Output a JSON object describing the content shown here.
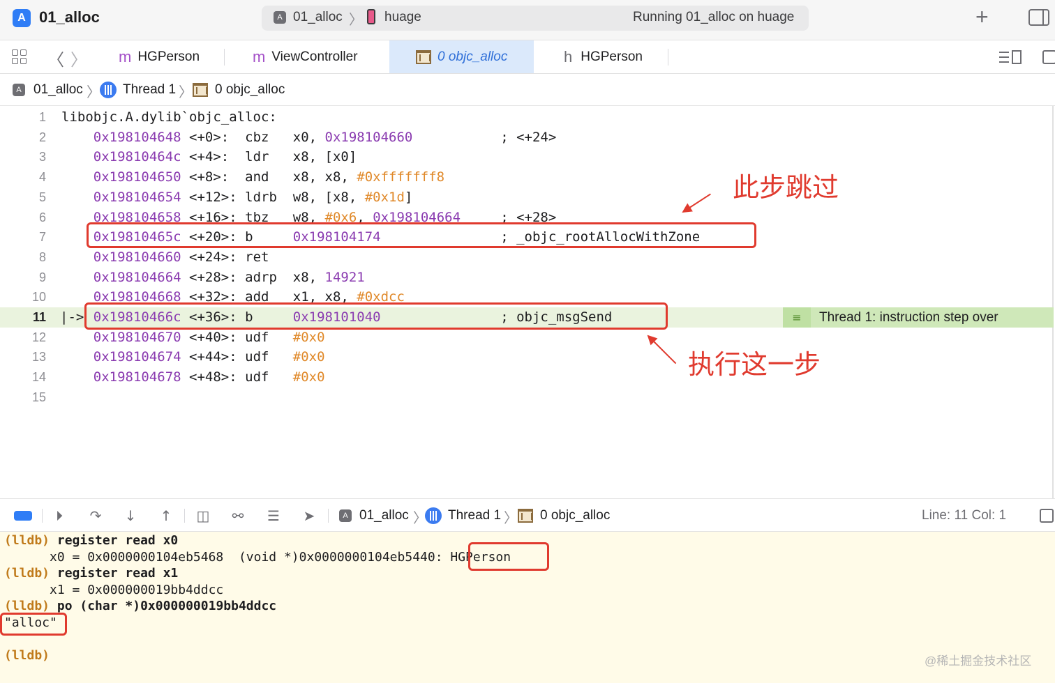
{
  "titlebar": {
    "app_title": "01_alloc",
    "scheme_target": "01_alloc",
    "device": "huage",
    "status": "Running 01_alloc on huage",
    "add_label": "+"
  },
  "tabs": [
    {
      "kind": "m",
      "label": "HGPerson"
    },
    {
      "kind": "m",
      "label": "ViewController"
    },
    {
      "kind": "asm",
      "label": "0 objc_alloc",
      "active": true
    },
    {
      "kind": "h",
      "label": "HGPerson"
    }
  ],
  "jumpbar": {
    "project": "01_alloc",
    "thread": "Thread 1",
    "frame": "0 objc_alloc"
  },
  "editor": {
    "lines": [
      {
        "n": "1",
        "addr": "",
        "off": "",
        "op": "",
        "args": "libobjc.A.dylib`objc_alloc:",
        "comment": ""
      },
      {
        "n": "2",
        "addr": "0x198104648",
        "off": " <+0>:  ",
        "op": "cbz ",
        "args": "x0, ",
        "arg_addr": "0x198104660",
        "comment": "; <+24>"
      },
      {
        "n": "3",
        "addr": "0x19810464c",
        "off": " <+4>:  ",
        "op": "ldr ",
        "args": "x8, [x0]",
        "comment": ""
      },
      {
        "n": "4",
        "addr": "0x198104650",
        "off": " <+8>:  ",
        "op": "and ",
        "args": "x8, x8, ",
        "arg_num": "#0xfffffff8",
        "comment": ""
      },
      {
        "n": "5",
        "addr": "0x198104654",
        "off": " <+12>: ",
        "op": "ldrb",
        "args": "w8, [x8, ",
        "arg_num": "#0x1d",
        "tail": "]",
        "comment": ""
      },
      {
        "n": "6",
        "addr": "0x198104658",
        "off": " <+16>: ",
        "op": "tbz ",
        "args": "w8, ",
        "arg_num": "#0x6",
        "tail": ", ",
        "arg_addr": "0x198104664",
        "comment": "; <+28>"
      },
      {
        "n": "7",
        "addr": "0x19810465c",
        "off": " <+20>: ",
        "op": "b   ",
        "args": "",
        "arg_addr": "0x198104174",
        "comment": "; _objc_rootAllocWithZone"
      },
      {
        "n": "8",
        "addr": "0x198104660",
        "off": " <+24>: ",
        "op": "ret ",
        "args": "",
        "comment": ""
      },
      {
        "n": "9",
        "addr": "0x198104664",
        "off": " <+28>: ",
        "op": "adrp",
        "args": "x8, ",
        "arg_addr": "14921",
        "comment": ""
      },
      {
        "n": "10",
        "addr": "0x198104668",
        "off": " <+32>: ",
        "op": "add ",
        "args": "x1, x8, ",
        "arg_num": "#0xdcc",
        "comment": ""
      },
      {
        "n": "11",
        "addr": "0x19810466c",
        "off": " <+36>: ",
        "op": "b   ",
        "args": "",
        "arg_addr": "0x198101040",
        "comment": "; objc_msgSend",
        "current": true
      },
      {
        "n": "12",
        "addr": "0x198104670",
        "off": " <+40>: ",
        "op": "udf ",
        "args": "",
        "arg_num": "#0x0",
        "comment": ""
      },
      {
        "n": "13",
        "addr": "0x198104674",
        "off": " <+44>: ",
        "op": "udf ",
        "args": "",
        "arg_num": "#0x0",
        "comment": ""
      },
      {
        "n": "14",
        "addr": "0x198104678",
        "off": " <+48>: ",
        "op": "udf ",
        "args": "",
        "arg_num": "#0x0",
        "comment": ""
      },
      {
        "n": "15",
        "addr": "",
        "off": "",
        "op": "",
        "args": "",
        "comment": ""
      }
    ],
    "pc_marker": "|->",
    "thread_annotation": "Thread 1: instruction step over",
    "annotation_skip": "此步跳过",
    "annotation_exec": "执行这一步"
  },
  "debugbar": {
    "project": "01_alloc",
    "thread": "Thread 1",
    "frame": "0 objc_alloc",
    "line_col": "Line: 11  Col: 1"
  },
  "console": {
    "lines": [
      {
        "prompt": "(lldb)",
        "text": " register read x0"
      },
      {
        "prompt": "",
        "text": "      x0 = 0x0000000104eb5468  (void *)0x0000000104eb5440: HGPerson"
      },
      {
        "prompt": "(lldb)",
        "text": " register read x1"
      },
      {
        "prompt": "",
        "text": "      x1 = 0x000000019bb4ddcc"
      },
      {
        "prompt": "(lldb)",
        "text": " po (char *)0x000000019bb4ddcc"
      },
      {
        "prompt": "",
        "text": "\"alloc\""
      },
      {
        "prompt": "",
        "text": ""
      },
      {
        "prompt": "(lldb)",
        "text": ""
      }
    ]
  },
  "watermark": "@稀土掘金技术社区",
  "colors": {
    "accent": "#2f7df6",
    "address": "#8a3bb0",
    "immediate": "#e0892a",
    "highlight_red": "#e03a2e",
    "current_line": "#eaf3de",
    "console_bg": "#fffbe8"
  }
}
